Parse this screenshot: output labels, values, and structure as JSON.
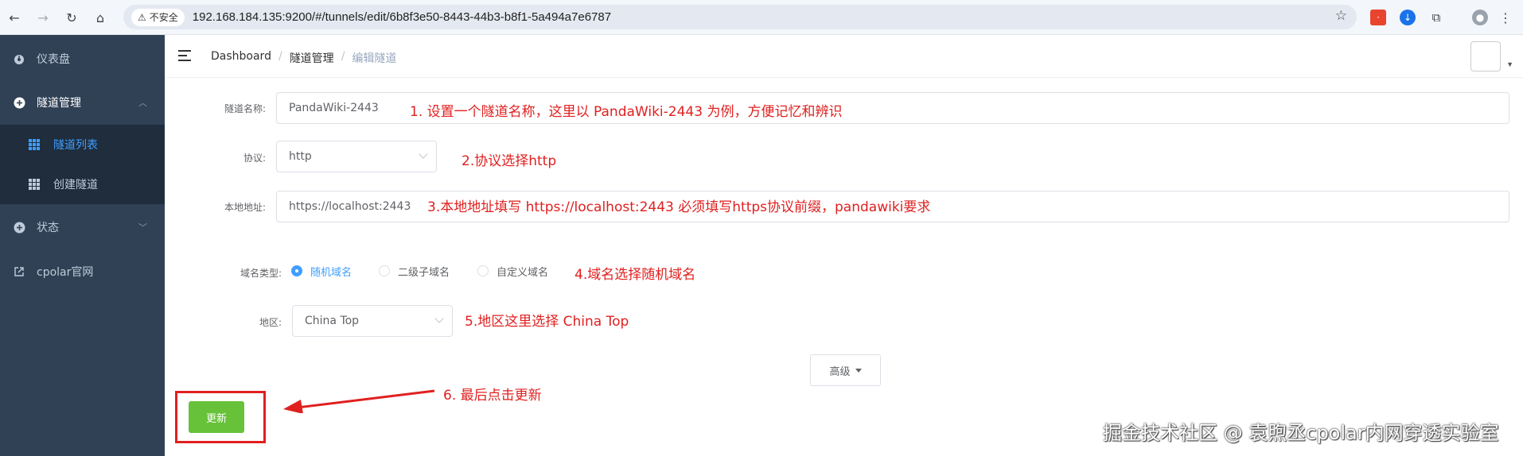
{
  "browser": {
    "security_label": "不安全",
    "url": "192.168.184.135:9200/#/tunnels/edit/6b8f3e50-8443-44b3-b8f1-5a494a7e6787"
  },
  "sidebar": {
    "items": [
      {
        "label": "仪表盘",
        "icon": "dashboard-icon"
      },
      {
        "label": "隧道管理",
        "icon": "plus-circle-icon"
      },
      {
        "label": "状态",
        "icon": "plus-circle-icon"
      },
      {
        "label": "cpolar官网",
        "icon": "external-link-icon"
      }
    ],
    "submenu": [
      {
        "label": "隧道列表",
        "active": true
      },
      {
        "label": "创建隧道",
        "active": false
      }
    ]
  },
  "breadcrumb": {
    "items": [
      "Dashboard",
      "隧道管理"
    ],
    "current": "编辑隧道",
    "separator": "/"
  },
  "form": {
    "name_label": "隧道名称:",
    "name_value": "PandaWiki-2443",
    "protocol_label": "协议:",
    "protocol_value": "http",
    "local_label": "本地地址:",
    "local_value": "https://localhost:2443",
    "domain_type_label": "域名类型:",
    "domain_options": [
      "随机域名",
      "二级子域名",
      "自定义域名"
    ],
    "domain_selected": "随机域名",
    "region_label": "地区:",
    "region_value": "China Top",
    "advanced_label": "高级",
    "update_label": "更新"
  },
  "annotations": {
    "note1": "1. 设置一个隧道名称，这里以 PandaWiki-2443 为例，方便记忆和辨识",
    "note2": "2.协议选择http",
    "note3": "3.本地地址填写  https://localhost:2443  必须填写https协议前缀，pandawiki要求",
    "note4": "4.域名选择随机域名",
    "note5": "5.地区这里选择 China Top",
    "note6": "6. 最后点击更新"
  },
  "watermark": "掘金技术社区 @ 袁煦丞cpolar内网穿透实验室",
  "colors": {
    "sidebar_bg": "#304156",
    "submenu_bg": "#1f2d3d",
    "active_blue": "#409eff",
    "annotation_red": "#e02020",
    "update_green": "#67c23a"
  }
}
